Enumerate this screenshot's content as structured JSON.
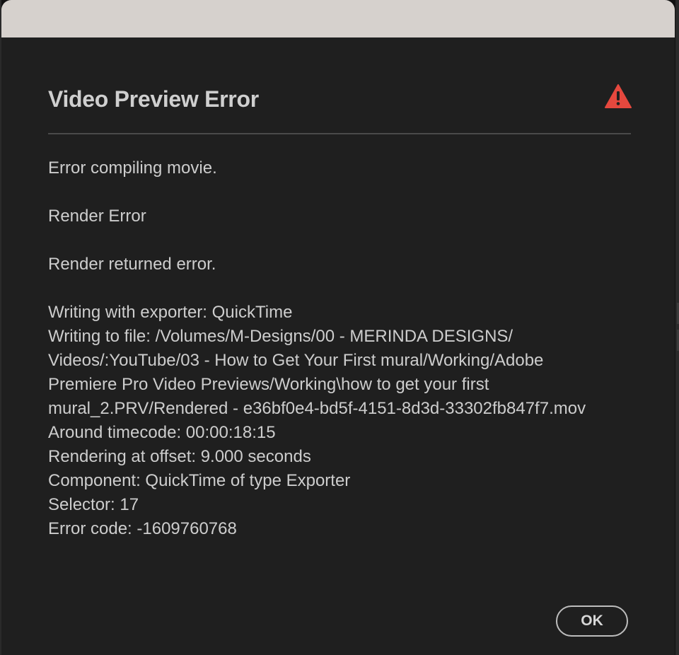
{
  "dialog": {
    "title": "Video Preview Error",
    "icon": "warning-icon",
    "icon_color": "#e5483e",
    "lines": [
      "Error compiling movie.",
      "",
      "Render Error",
      "",
      "Render returned error.",
      "",
      "Writing with exporter: QuickTime",
      "Writing to file: /Volumes/M-Designs/00 - MERINDA DESIGNS/",
      "Videos/:YouTube/03 - How to Get Your First mural/Working/Adobe",
      "Premiere Pro Video Previews/Working\\how to get your first",
      "mural_2.PRV/Rendered - e36bf0e4-bd5f-4151-8d3d-33302fb847f7.mov",
      "Around timecode: 00:00:18:15",
      "Rendering at offset: 9.000 seconds",
      "Component: QuickTime of type Exporter",
      "Selector: 17",
      "Error code: -1609760768"
    ],
    "ok_label": "OK"
  },
  "colors": {
    "window_bg": "#1f1f1f",
    "titlebar_bg": "#d6d1cd",
    "text": "#cdcdcd",
    "button_border": "#bdbdbd"
  }
}
